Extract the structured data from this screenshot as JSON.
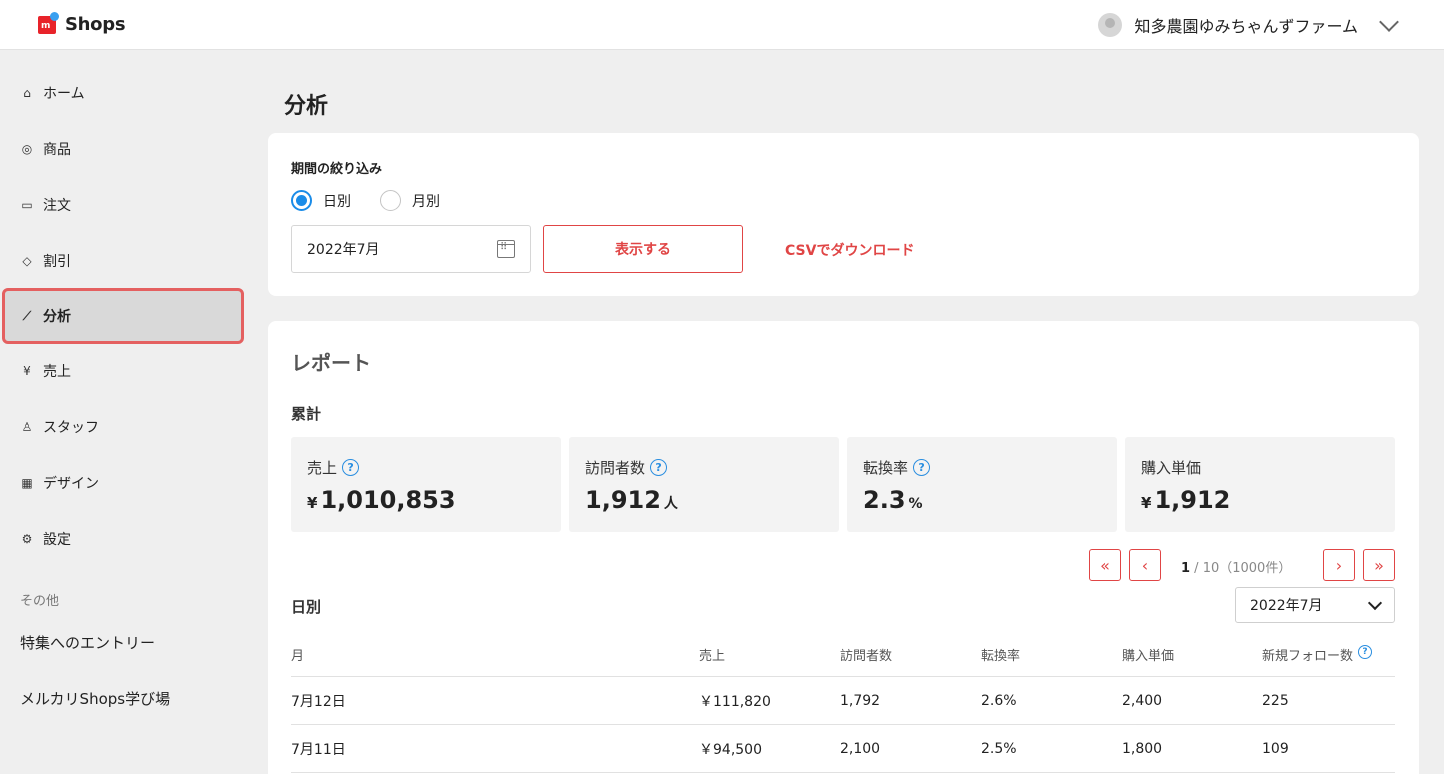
{
  "header": {
    "logo_text": "Shops",
    "logo_mark_letter": "m",
    "user_name": "知多農園ゆみちゃんずファーム"
  },
  "sidebar": {
    "items": [
      {
        "label": "ホーム",
        "icon": "home-icon",
        "glyph": "⌂"
      },
      {
        "label": "商品",
        "icon": "camera-icon",
        "glyph": "◎"
      },
      {
        "label": "注文",
        "icon": "box-icon",
        "glyph": "▭"
      },
      {
        "label": "割引",
        "icon": "tag-icon",
        "glyph": "◇"
      },
      {
        "label": "分析",
        "icon": "chart-icon",
        "glyph": "⟋"
      },
      {
        "label": "売上",
        "icon": "yen-icon",
        "glyph": "¥"
      },
      {
        "label": "スタッフ",
        "icon": "person-icon",
        "glyph": "♙"
      },
      {
        "label": "デザイン",
        "icon": "store-icon",
        "glyph": "▦"
      },
      {
        "label": "設定",
        "icon": "gear-icon",
        "glyph": "⚙"
      }
    ],
    "active_label": "分析",
    "other_section": "その他",
    "links": [
      "特集へのエントリー",
      "メルカリShops学び場"
    ]
  },
  "page": {
    "title": "分析"
  },
  "filter": {
    "label": "期間の絞り込み",
    "radio_daily": "日別",
    "radio_monthly": "月別",
    "selected": "日別",
    "date_value": "2022年7月",
    "show_button": "表示する",
    "csv_link": "CSVでダウンロード"
  },
  "report": {
    "title": "レポート",
    "cumulative_label": "累計",
    "stats": [
      {
        "label": "売上",
        "prefix": "¥",
        "value": "1,010,853",
        "suffix": "",
        "help": true
      },
      {
        "label": "訪問者数",
        "prefix": "",
        "value": "1,912",
        "suffix": "人",
        "help": true
      },
      {
        "label": "転換率",
        "prefix": "",
        "value": "2.3",
        "suffix": "%",
        "help": true
      },
      {
        "label": "購入単価",
        "prefix": "¥",
        "value": "1,912",
        "suffix": "",
        "help": false
      }
    ],
    "pager": {
      "current": "1",
      "rest": " / 10（1000件）",
      "first": "«",
      "prev": "‹",
      "next": "›",
      "last": "»"
    },
    "daily_label": "日別",
    "month_select": "2022年7月",
    "table": {
      "columns": [
        "月",
        "売上",
        "訪問者数",
        "転換率",
        "購入単価",
        "新規フォロー数"
      ],
      "rows": [
        [
          "7月12日",
          "￥111,820",
          "1,792",
          "2.6%",
          "2,400",
          "225"
        ],
        [
          "7月11日",
          "￥94,500",
          "2,100",
          "2.5%",
          "1,800",
          "109"
        ]
      ]
    }
  },
  "colors": {
    "accent_red": "#e04545",
    "radio_blue": "#1a8ce8",
    "help_blue": "#2a8ee0",
    "active_border": "#e46060"
  }
}
